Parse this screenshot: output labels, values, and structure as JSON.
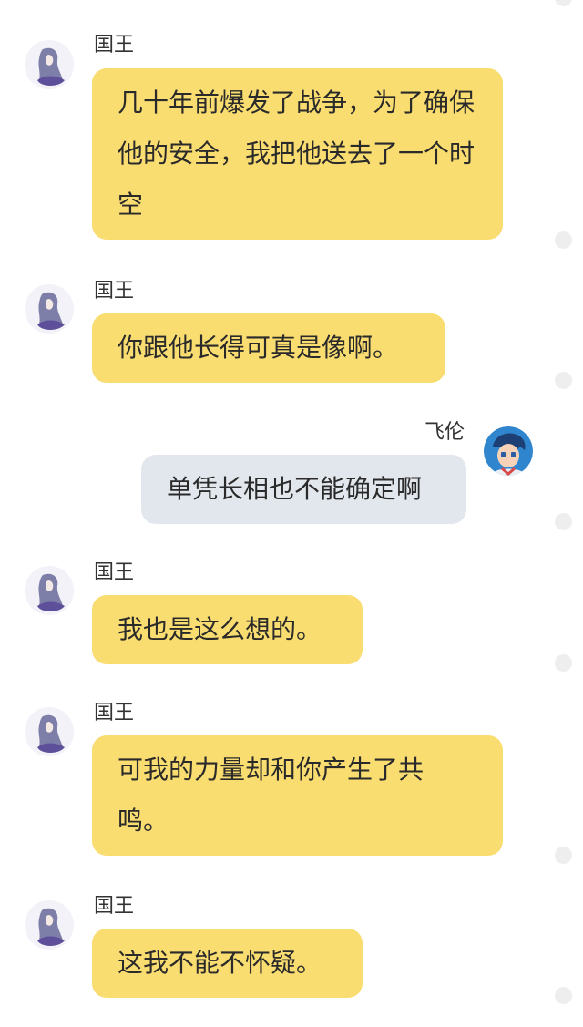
{
  "messages": [
    {
      "sender": "国王",
      "side": "left",
      "text": "几十年前爆发了战争，为了确保他的安全，我把他送去了一个时空"
    },
    {
      "sender": "国王",
      "side": "left",
      "text": "你跟他长得可真是像啊。"
    },
    {
      "sender": "飞伦",
      "side": "right",
      "text": "单凭长相也不能确定啊"
    },
    {
      "sender": "国王",
      "side": "left",
      "text": "我也是这么想的。"
    },
    {
      "sender": "国王",
      "side": "left",
      "text": "可我的力量却和你产生了共鸣。"
    },
    {
      "sender": "国王",
      "side": "left",
      "text": "这我不能不怀疑。"
    }
  ],
  "colors": {
    "left_bubble": "#fadd71",
    "right_bubble": "#e2e7ed",
    "background": "#ffffff"
  },
  "icons": {
    "king_avatar": "king-avatar-icon",
    "feilun_avatar": "feilun-avatar-icon",
    "message_dot": "dot-icon"
  }
}
